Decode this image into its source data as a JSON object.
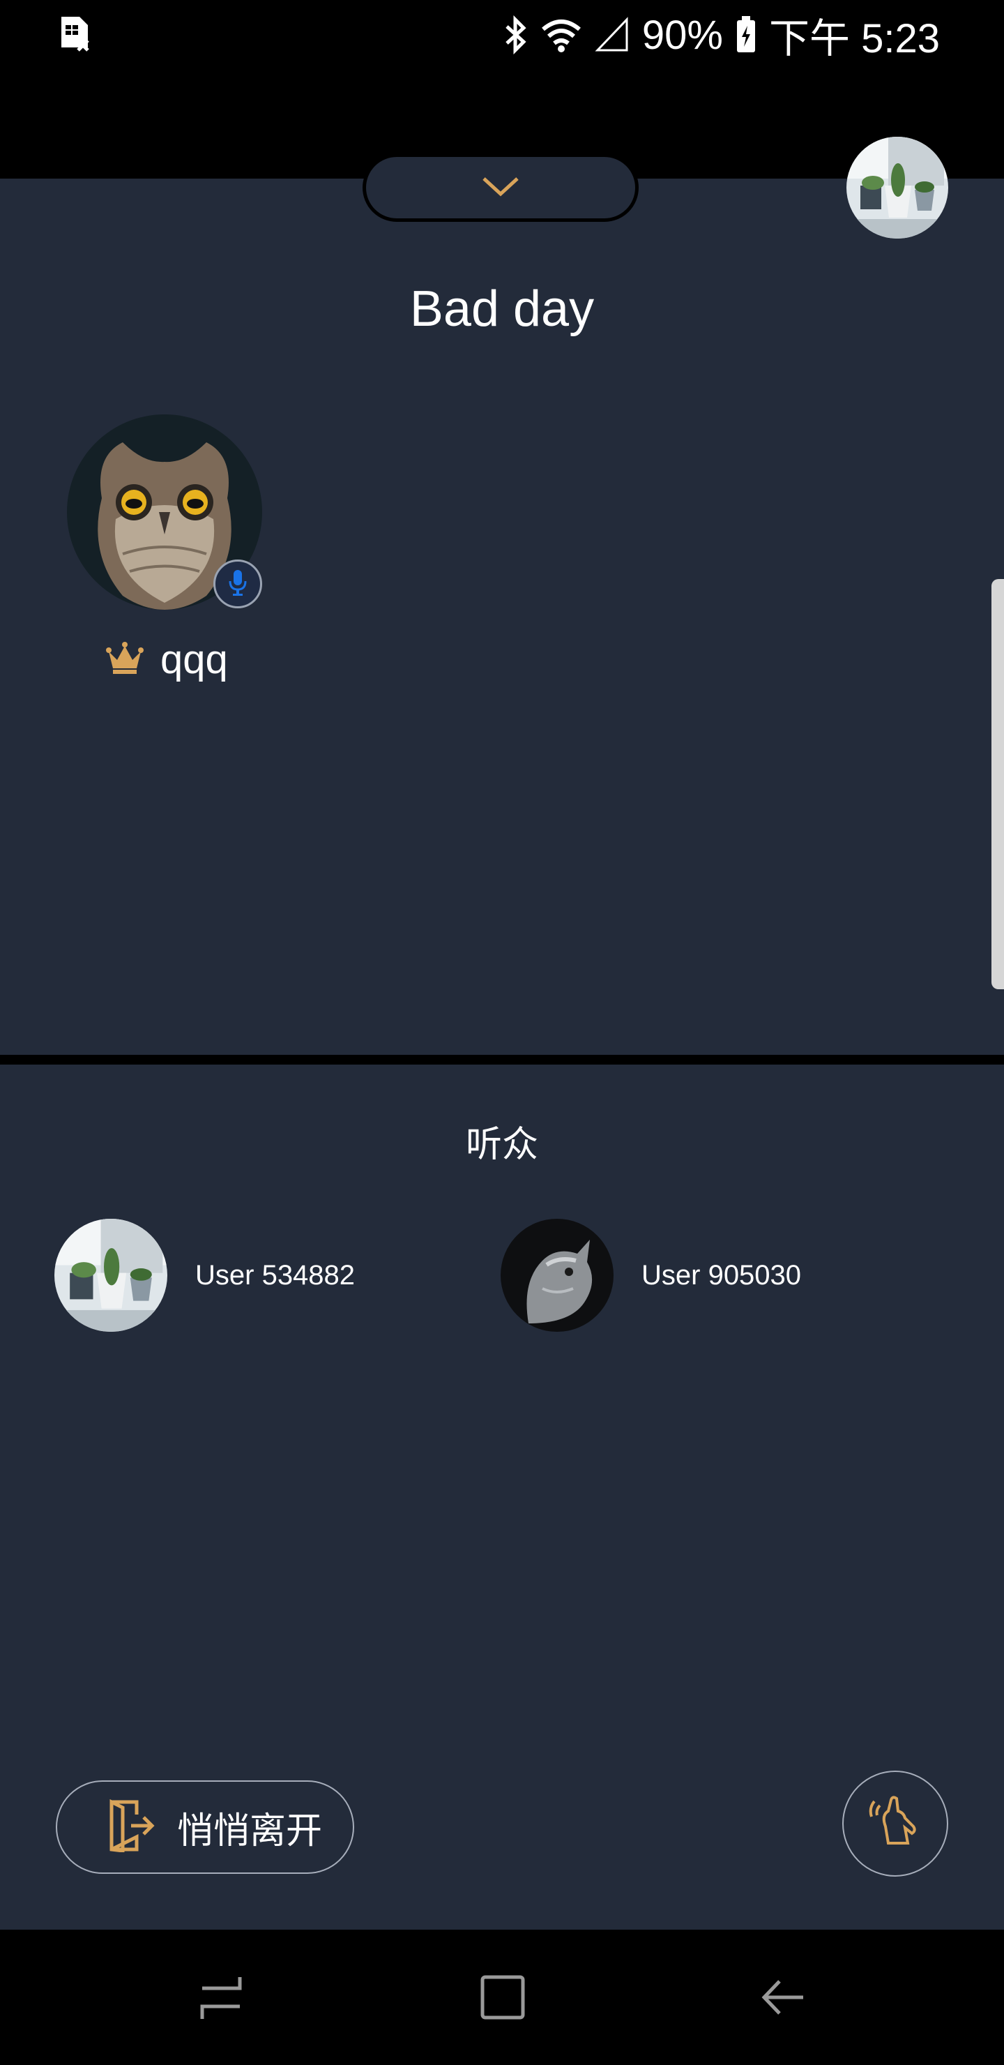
{
  "status_bar": {
    "battery": "90%",
    "time": "下午 5:23"
  },
  "room": {
    "title": "Bad day",
    "speaker": {
      "name": "qqq"
    }
  },
  "audience": {
    "title": "听众",
    "listeners": [
      {
        "name": "User 534882"
      },
      {
        "name": "User 905030"
      }
    ]
  },
  "actions": {
    "leave_label": "悄悄离开"
  },
  "colors": {
    "background": "#232b3a",
    "accent": "#d9a45a",
    "mic_blue": "#1a73e8"
  },
  "icons": [
    "sim-card-icon",
    "bluetooth-icon",
    "wifi-icon",
    "signal-icon",
    "battery-icon",
    "chevron-down-icon",
    "mic-icon",
    "crown-icon",
    "exit-door-icon",
    "raise-hand-icon",
    "recents-icon",
    "home-icon",
    "back-icon"
  ]
}
